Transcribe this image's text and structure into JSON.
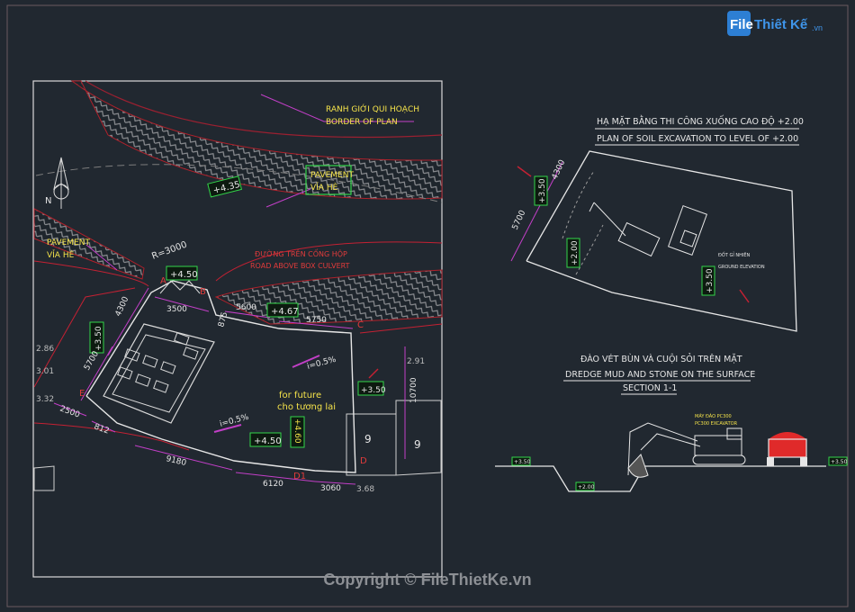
{
  "logo": {
    "text_a": "File",
    "text_b": "Thiết Kế",
    "text_c": ".vn"
  },
  "copyright": "Copyright © FileThietKe.vn",
  "plan": {
    "north": "N",
    "ranh_gioi_vn": "RANH GIỚI QUI HOẠCH",
    "ranh_gioi_en": "BORDER OF PLAN",
    "pavement_top_en": "PAVEMENT",
    "pavement_top_vn": "VỈA HÈ",
    "pavement_left_en": "PAVEMENT",
    "pavement_left_vn": "VỈA HÈ",
    "road_vn": "ĐƯỜNG TRÊN CỐNG HỘP",
    "road_en": "ROAD ABOVE BOX CULVERT",
    "radius": "R=3000",
    "future_en": "for future",
    "future_vn": "cho tương lai",
    "lvl_435": "+4.35",
    "lvl_450a": "+4.50",
    "lvl_467": "+4.67",
    "lvl_350a": "+3.50",
    "lvl_350b": "+3.50",
    "lvl_450b": "+4.50",
    "lvl_460": "+4.60",
    "slope1": "i=0.5%",
    "slope2": "i=0.5%",
    "dim_4300": "4300",
    "dim_3500": "3500",
    "dim_5600": "5600",
    "dim_875": "875",
    "dim_5750": "5750",
    "dim_5700": "5700",
    "dim_2500": "2500",
    "dim_812": "812",
    "dim_9180": "9180",
    "dim_6120": "6120",
    "dim_3060": "3060",
    "dim_10700": "10700",
    "elev_286": "2.86",
    "elev_301": "3.01",
    "elev_332": "3.32",
    "elev_291": "2.91",
    "elev_368": "3.68",
    "lot_a": "9",
    "lot_b": "9",
    "pt_a": "A",
    "pt_b": "B",
    "pt_c": "C",
    "pt_d": "D",
    "pt_d1": "D1",
    "pt_e": "E"
  },
  "excavation": {
    "title_vn": "HẠ MẶT BẰNG THI CÔNG XUỐNG CAO ĐỘ +2.00",
    "title_en": "PLAN OF SOIL EXCAVATION TO LEVEL OF +2.00",
    "dim_4300": "4300",
    "dim_5700": "5700",
    "lvl_350a": "+3.50",
    "lvl_200": "+2.00",
    "lvl_350b": "+3.50",
    "note_vn": "ĐỐT GỈ NHIÊN",
    "note_en": "GROUND ELEVATION"
  },
  "section": {
    "title_vn": "ĐÀO VÉT BÙN VÀ CUỘI SỎI TRÊN MẶT",
    "title_en": "DREDGE MUD AND STONE ON THE SURFACE",
    "label": "SECTION 1-1",
    "excavator_vn": "MÁY ĐÀO PC300",
    "excavator_en": "PC300 EXCAVATOR",
    "lvl_left": "+3.50",
    "lvl_bottom": "+2.00",
    "lvl_right": "+3.50"
  }
}
